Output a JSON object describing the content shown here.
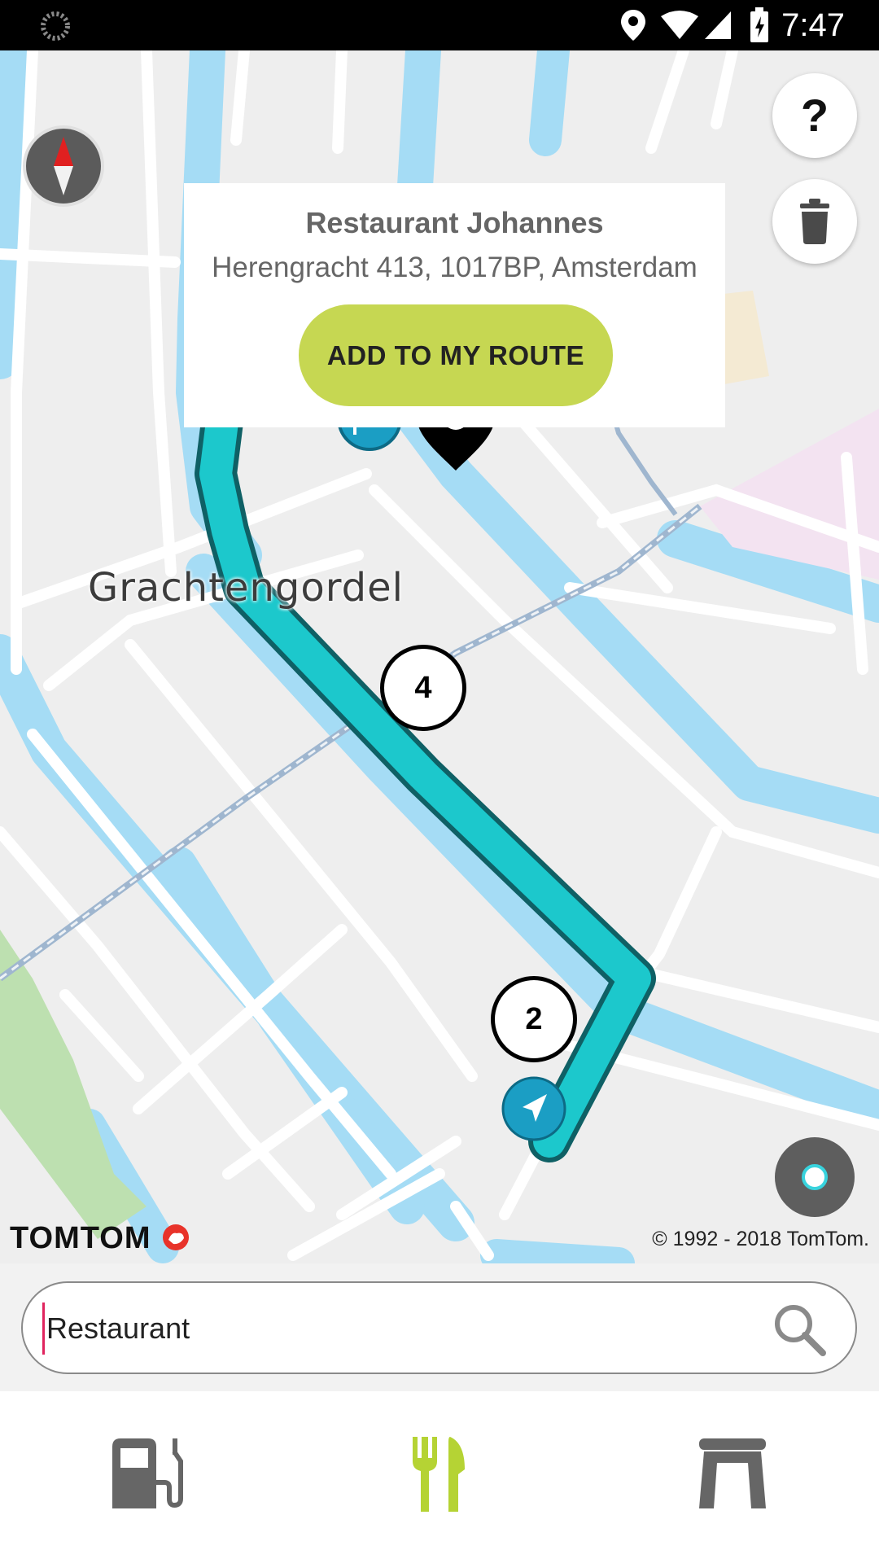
{
  "status_bar": {
    "time": "7:47"
  },
  "popup": {
    "title": "Restaurant Johannes",
    "address": "Herengracht 413, 1017BP, Amsterdam",
    "add_button": "ADD TO MY ROUTE"
  },
  "map": {
    "area_label": "Grachtengordel",
    "markers": [
      "4",
      "2"
    ],
    "brand": "TOMTOM",
    "copyright": "© 1992 - 2018 TomTom."
  },
  "help_button": "?",
  "search": {
    "value": "Restaurant"
  },
  "categories": [
    {
      "icon": "fuel-pump-icon",
      "active": false
    },
    {
      "icon": "fork-knife-icon",
      "active": true
    },
    {
      "icon": "parking-garage-icon",
      "active": false
    }
  ],
  "colors": {
    "route": "#1cc8cc",
    "water": "#a5dcf5",
    "accent": "#c6d752",
    "active_icon": "#b5d334",
    "inactive_icon": "#666666"
  }
}
